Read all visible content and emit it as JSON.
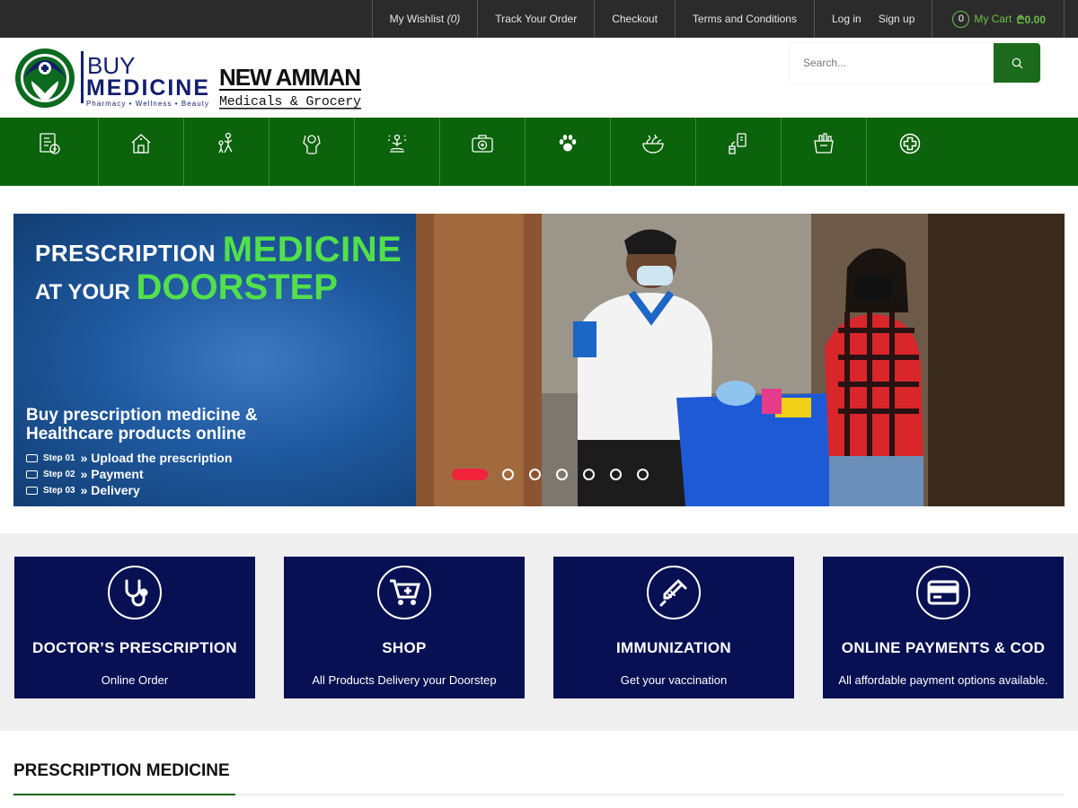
{
  "topbar": {
    "wishlist_label": "My Wishlist",
    "wishlist_count": "(0)",
    "track_order": "Track Your Order",
    "checkout": "Checkout",
    "terms": "Terms and Conditions",
    "login": "Log in",
    "signup": "Sign up",
    "cart_count": "0",
    "cart_label": "My Cart",
    "cart_total": "₾0.00"
  },
  "header": {
    "logo_buy": "BUY",
    "logo_medicine": "MEDICINE",
    "logo_tagline": "Pharmacy • Wellness • Beauty",
    "logo2_line1": "NEW AMMAN",
    "logo2_line2": "Medicals & Grocery",
    "search_placeholder": "Search..."
  },
  "nav": {
    "icons": [
      "prescription-icon",
      "home-care-icon",
      "mother-baby-icon",
      "personal-care-icon",
      "wellness-icon",
      "first-aid-icon",
      "pet-care-icon",
      "food-nutrition-icon",
      "devices-icon",
      "grocery-icon",
      "health-plus-icon"
    ]
  },
  "banner": {
    "h1_white": "PRESCRIPTION",
    "h1_green": "MEDICINE",
    "h2_white": "AT YOUR",
    "h2_green": "DOORSTEP",
    "subtitle": "Buy prescription medicine & Healthcare products online",
    "steps": [
      {
        "num": "Step 01",
        "text": "Upload the prescription"
      },
      {
        "num": "Step 02",
        "text": "Payment"
      },
      {
        "num": "Step 03",
        "text": "Delivery"
      }
    ],
    "slide_count": 7,
    "active_slide": 1
  },
  "features": [
    {
      "title": "DOCTOR’S PRESCRIPTION",
      "subtitle": "Online Order",
      "icon": "stethoscope-icon"
    },
    {
      "title": "SHOP",
      "subtitle": "All Products Delivery your Doorstep",
      "icon": "cart-plus-icon"
    },
    {
      "title": "IMMUNIZATION",
      "subtitle": "Get your vaccination",
      "icon": "syringe-icon"
    },
    {
      "title": "ONLINE PAYMENTS & COD",
      "subtitle": "All affordable payment options available.",
      "icon": "credit-card-icon"
    }
  ],
  "section": {
    "title": "PRESCRIPTION MEDICINE"
  },
  "colors": {
    "topbar_bg": "#2b2b2b",
    "nav_green": "#0b630b",
    "feature_navy": "#071052",
    "accent_green": "#6cc04a",
    "slider_active": "#f2243b"
  }
}
